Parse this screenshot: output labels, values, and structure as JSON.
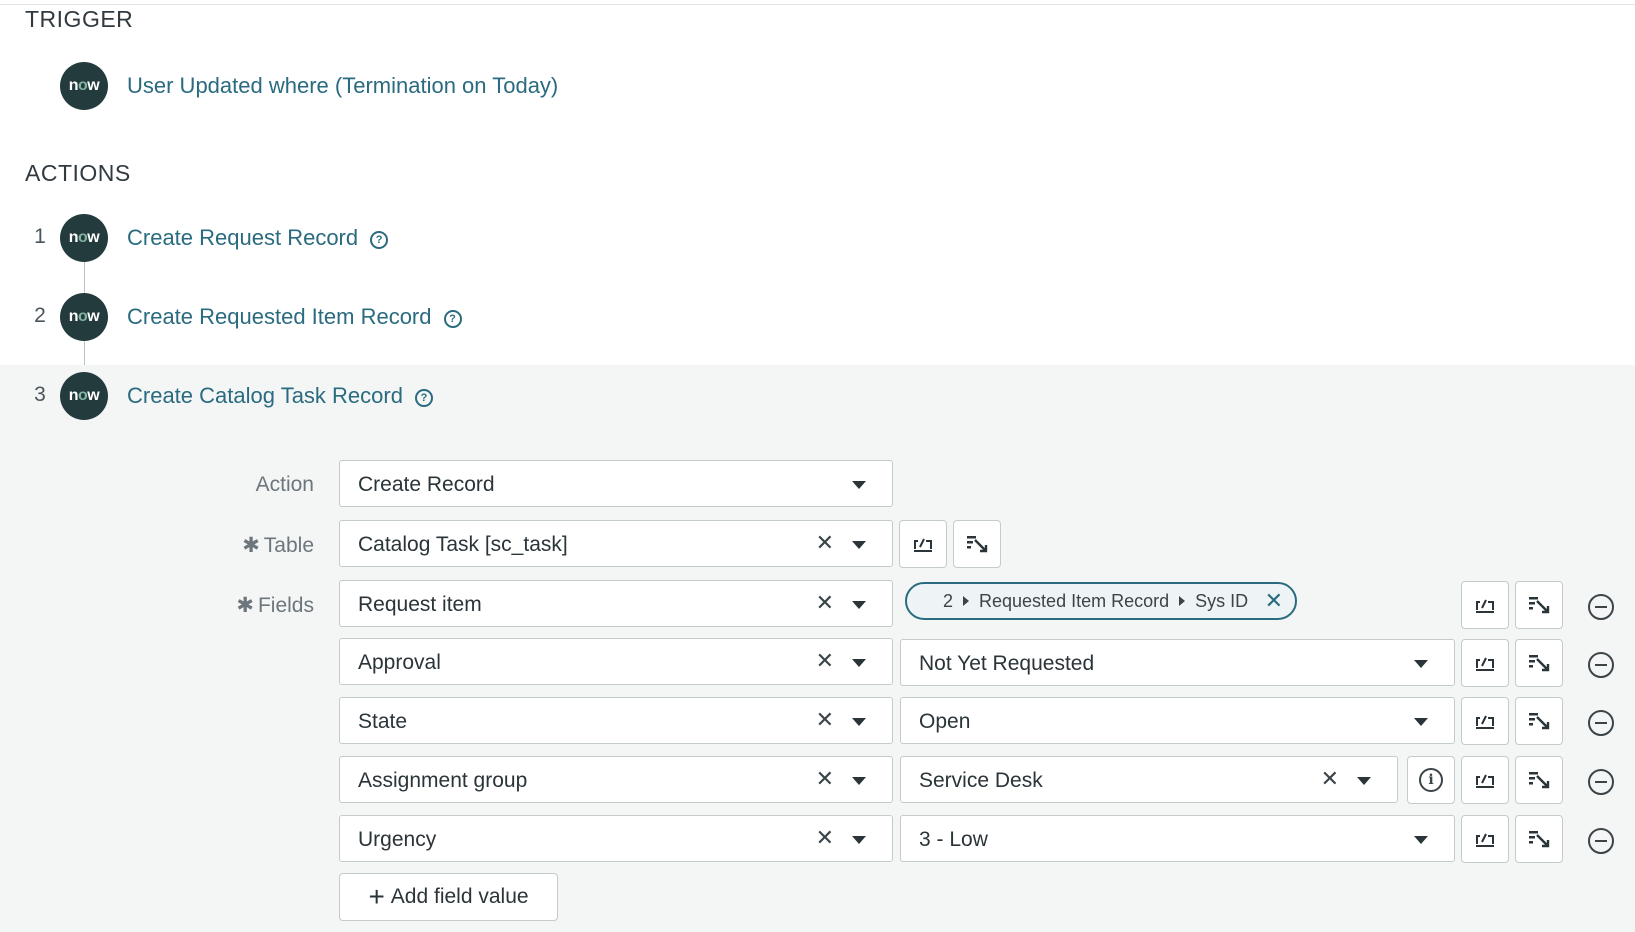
{
  "trigger": {
    "heading": "TRIGGER",
    "title": "User Updated where (Termination on Today)"
  },
  "actions": {
    "heading": "ACTIONS",
    "steps": [
      {
        "num": "1",
        "title": "Create Request Record"
      },
      {
        "num": "2",
        "title": "Create Requested Item Record"
      },
      {
        "num": "3",
        "title": "Create Catalog Task Record"
      }
    ]
  },
  "logo_text": {
    "n": "n",
    "o": "o",
    "w": "w"
  },
  "icons": {
    "help": "?",
    "info": "i",
    "clear": "✕",
    "plus": "+"
  },
  "form": {
    "action_label": "Action",
    "action_value": "Create Record",
    "table_label": "Table",
    "table_value": "Catalog Task [sc_task]",
    "fields_label": "Fields",
    "required_mark": "✱",
    "fields": [
      {
        "name": "Request item",
        "pill": {
          "step": "2",
          "record": "Requested Item Record",
          "field": "Sys ID"
        }
      },
      {
        "name": "Approval",
        "value": "Not Yet Requested"
      },
      {
        "name": "State",
        "value": "Open"
      },
      {
        "name": "Assignment group",
        "value": "Service Desk"
      },
      {
        "name": "Urgency",
        "value": "3 - Low"
      }
    ],
    "add_field_label": "Add field value"
  },
  "colors": {
    "link": "#2a6b80",
    "logo_bg": "#243b3e",
    "logo_accent": "#81b5a1",
    "panel_bg": "#f4f6f6"
  }
}
